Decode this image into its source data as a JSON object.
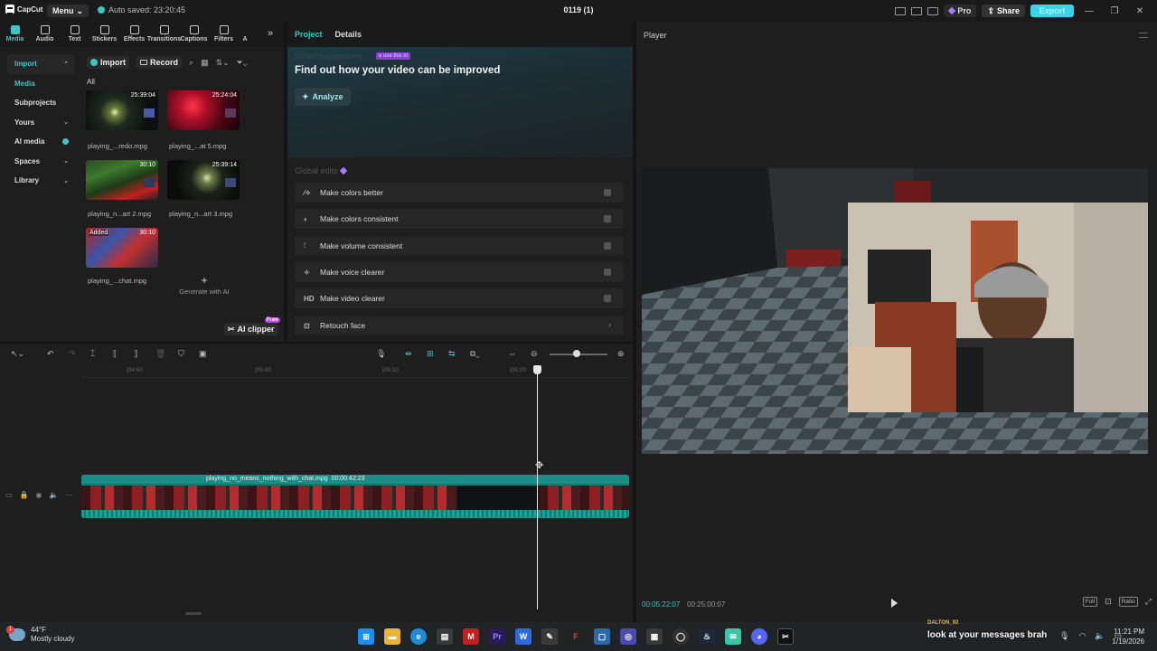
{
  "topbar": {
    "logo": "CapCut",
    "menu_label": "Menu",
    "autosave": "Auto saved: 23:20:45",
    "project_title": "0119 (1)",
    "pro_label": "Pro",
    "share_label": "Share",
    "export_label": "Export",
    "accent_color": "#3ec5c5"
  },
  "tooltabs": [
    {
      "label": "Media",
      "icon": "media-icon"
    },
    {
      "label": "Audio",
      "icon": "audio-icon"
    },
    {
      "label": "Text",
      "icon": "text-icon"
    },
    {
      "label": "Stickers",
      "icon": "sticker-icon"
    },
    {
      "label": "Effects",
      "icon": "effects-icon"
    },
    {
      "label": "Transitions",
      "icon": "transitions-icon"
    },
    {
      "label": "Captions",
      "icon": "captions-icon"
    },
    {
      "label": "Filters",
      "icon": "filters-icon"
    },
    {
      "label": "A",
      "icon": "adjust-icon"
    }
  ],
  "media": {
    "sidebar": [
      "Import",
      "Media",
      "Subprojects",
      "Yours",
      "AI media",
      "Spaces",
      "Library"
    ],
    "import_label": "Import",
    "record_label": "Record",
    "all_label": "All",
    "items": [
      {
        "name": "playing_...redo.mpg",
        "duration": "25:39:04"
      },
      {
        "name": "playing_...at 5.mpg",
        "duration": "25:24:04"
      },
      {
        "name": "playing_n...art 2.mpg",
        "duration": "30:10"
      },
      {
        "name": "playing_n...art 3.mpg",
        "duration": "25:39:14"
      },
      {
        "name": "playing_...chat.mpg",
        "duration": "30:10",
        "tag": "Added"
      }
    ],
    "generate_label": "Generate with AI",
    "ai_clipper_label": "AI clipper",
    "ai_clipper_badge": "Free"
  },
  "project": {
    "tabs": [
      "Project",
      "Details"
    ],
    "smart_label": "Smart suggestions",
    "use_this_badge": "e use this m",
    "improve_title": "Find out how your video can be improved",
    "analyze_label": "Analyze",
    "global_label": "Global edits",
    "edits": [
      {
        "label": "Make colors better",
        "icon": "wand-icon"
      },
      {
        "label": "Make colors consistent",
        "icon": "palette-icon"
      },
      {
        "label": "Make volume consistent",
        "icon": "volume-icon"
      },
      {
        "label": "Make voice clearer",
        "icon": "voice-icon"
      },
      {
        "label": "Make video clearer",
        "icon": "hd-icon",
        "icon_text": "HD"
      },
      {
        "label": "Retouch face",
        "icon": "face-icon"
      }
    ]
  },
  "player": {
    "label": "Player",
    "timecode_current": "00:05:22:07",
    "timecode_total": "00:25:00:07",
    "controls": [
      "Full",
      "Ratio"
    ]
  },
  "timeline": {
    "ruler": [
      "|04:50",
      "|05:00",
      "|05:10",
      "|05:20"
    ],
    "clip_label": "playing_no_means_nothing_with_chat.mpg",
    "clip_duration": "00:00:42:23"
  },
  "taskbar": {
    "temperature": "44°F",
    "weather": "Mostly cloudy",
    "weather_badge": "1",
    "chat_user": "DALTON_92",
    "chat_message": "look at your messages brah",
    "time": "11:21 PM",
    "date": "1/19/2026"
  }
}
